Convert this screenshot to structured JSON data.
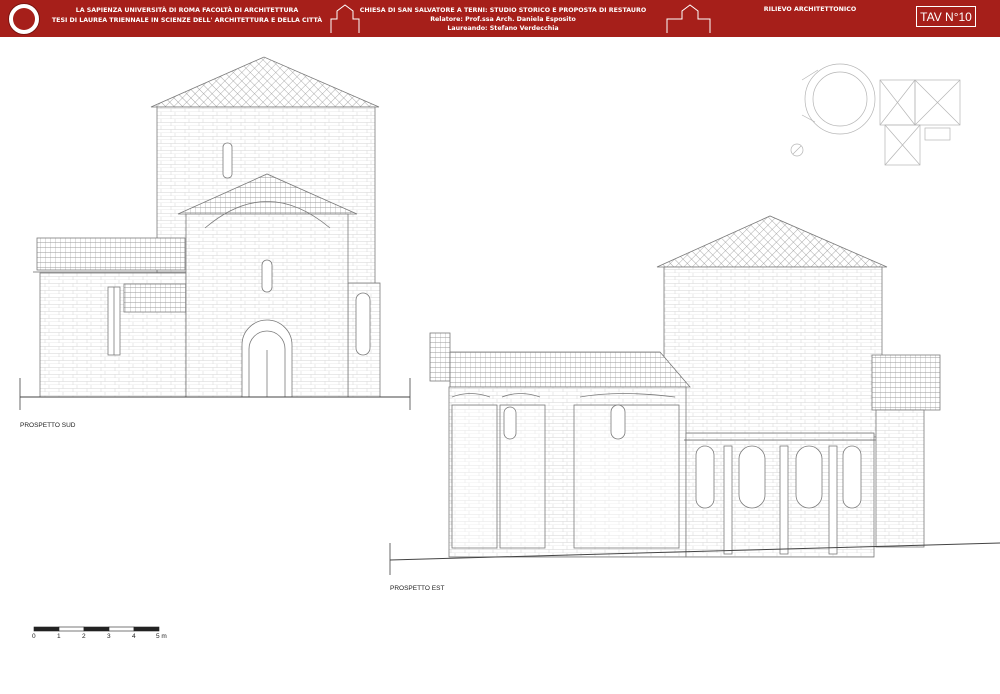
{
  "header": {
    "university_line1": "LA SAPIENZA UNIVERSITÀ DI ROMA   FACOLTÀ DI ARCHITETTURA",
    "university_line2": "TESI DI LAUREA TRIENNALE IN SCIENZE DELL' ARCHITETTURA E DELLA CITTÀ",
    "project_title": "CHIESA DI SAN SALVATORE A TERNI: STUDIO STORICO E PROPOSTA DI RESTAURO",
    "relatore": "Relatore: Prof.ssa Arch. Daniela Esposito",
    "laureando": "Laureando: Stefano Verdecchia",
    "section": "RILIEVO ARCHITETTONICO",
    "sheet": "TAV N°10"
  },
  "drawings": {
    "south_label": "PROSPETTO SUD",
    "east_label": "PROSPETTO EST"
  },
  "scale_bar": {
    "ticks": [
      "0",
      "1",
      "2",
      "3",
      "4",
      "5 m"
    ]
  },
  "colors": {
    "header_bg": "#a61f1a",
    "line": "#8a8a8a"
  }
}
